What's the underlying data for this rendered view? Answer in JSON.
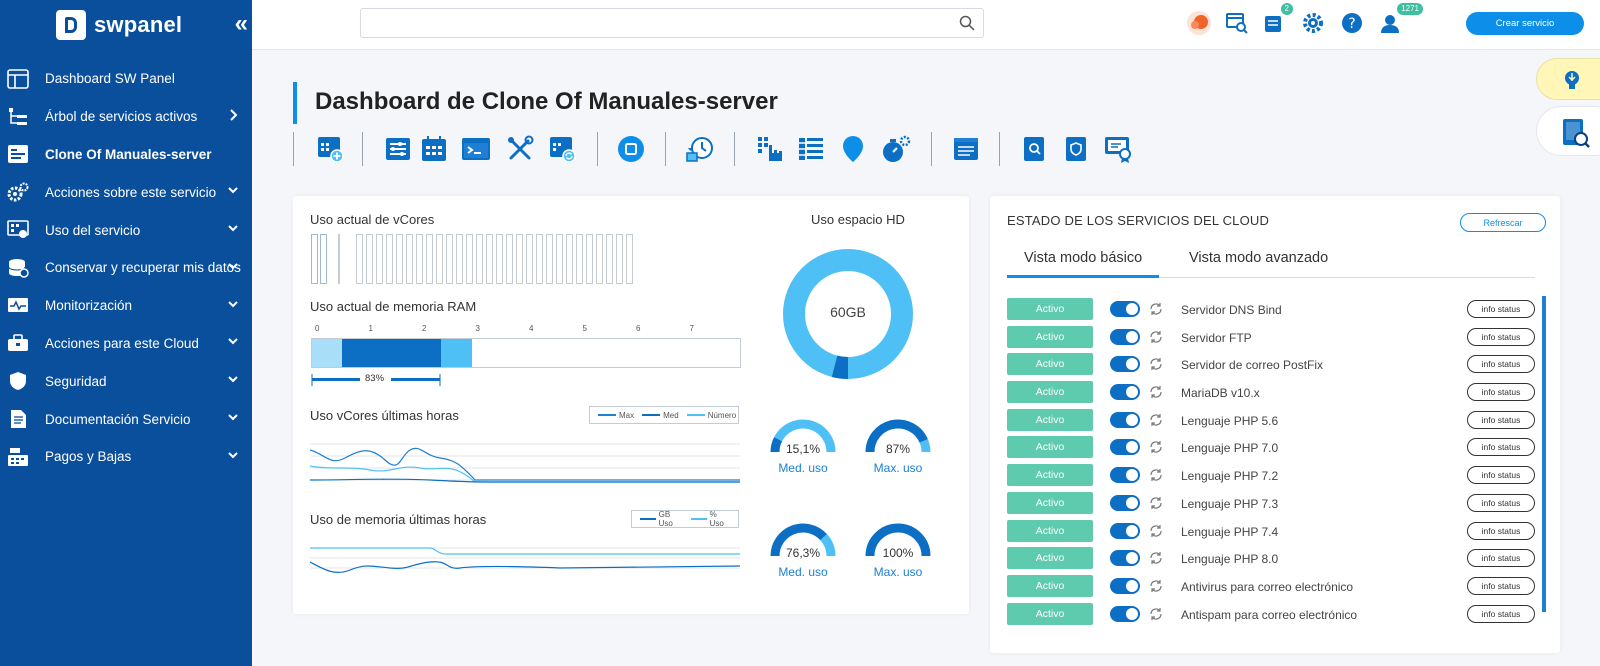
{
  "brand": {
    "name": "swpanel",
    "collapse_label": "«"
  },
  "sidebar": {
    "items": [
      {
        "label": "Dashboard SW Panel",
        "icon": "dashboard-icon",
        "arrow": ""
      },
      {
        "label": "Árbol de servicios activos",
        "icon": "tree-icon",
        "arrow": ">"
      },
      {
        "label": "Clone Of Manuales-server",
        "icon": "server-icon",
        "arrow": ""
      },
      {
        "label": "Acciones sobre este servicio",
        "icon": "gears-icon",
        "arrow": "v"
      },
      {
        "label": "Uso del servicio",
        "icon": "usage-icon",
        "arrow": "v"
      },
      {
        "label": "Conservar y recuperar mis datos",
        "icon": "database-icon",
        "arrow": "v"
      },
      {
        "label": "Monitorización",
        "icon": "monitor-icon",
        "arrow": "v"
      },
      {
        "label": "Acciones para este Cloud",
        "icon": "toolbox-icon",
        "arrow": "v"
      },
      {
        "label": "Seguridad",
        "icon": "shield-icon",
        "arrow": "v"
      },
      {
        "label": "Documentación Servicio",
        "icon": "document-icon",
        "arrow": "v"
      },
      {
        "label": "Pagos y Bajas",
        "icon": "cash-register-icon",
        "arrow": "v"
      }
    ]
  },
  "topbar": {
    "search_placeholder": "",
    "badges": {
      "messages": "2",
      "users": "1271"
    },
    "create_label": "Crear servicio"
  },
  "page": {
    "title_prefix": "Dashboard de ",
    "title_server": "Clone Of Manuales-server"
  },
  "metrics": {
    "vcores_title": "Uso actual de vCores",
    "ram_title": "Uso actual de memoria RAM",
    "ram_axis": [
      "0",
      "1",
      "2",
      "3",
      "4",
      "5",
      "6",
      "7"
    ],
    "ram_percent": "83%",
    "vcores_hours_title": "Uso vCores últimas horas",
    "vcores_legend": [
      "Max",
      "Med",
      "Número"
    ],
    "mem_hours_title": "Uso de memoria últimas horas",
    "mem_legend": [
      "GB Uso",
      "% Uso"
    ],
    "hd_title": "Uso espacio HD",
    "hd_value": "60GB",
    "hd_used_fraction": 0.04,
    "gauges": [
      {
        "value": "15,1%",
        "label": "Med. uso",
        "fraction": 0.151
      },
      {
        "value": "87%",
        "label": "Max. uso",
        "fraction": 0.87
      },
      {
        "value": "76,3%",
        "label": "Med. uso",
        "fraction": 0.763
      },
      {
        "value": "100%",
        "label": "Max. uso",
        "fraction": 1.0
      }
    ]
  },
  "services": {
    "title": "ESTADO DE LOS SERVICIOS DEL CLOUD",
    "refresh_label": "Refrescar",
    "tabs": [
      "Vista modo básico",
      "Vista modo avanzado"
    ],
    "status_label": "Activo",
    "info_label": "info status",
    "items": [
      "Servidor DNS Bind",
      "Servidor FTP",
      "Servidor de correo PostFix",
      "MariaDB v10.x",
      "Lenguaje PHP 5.6",
      "Lenguaje PHP 7.0",
      "Lenguaje PHP 7.2",
      "Lenguaje PHP 7.3",
      "Lenguaje PHP 7.4",
      "Lenguaje PHP 8.0",
      "Antivirus para correo electrónico",
      "Antispam para correo electrónico"
    ]
  },
  "colors": {
    "sidebar": "#0a4f9c",
    "accent": "#0d8ee8",
    "light_blue": "#4fc0f5",
    "dark_blue": "#0d6fc4",
    "active_green": "#5fcbae"
  }
}
